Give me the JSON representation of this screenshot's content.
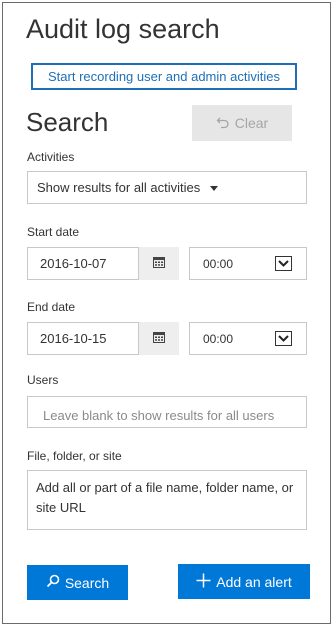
{
  "page": {
    "title": "Audit log search",
    "record_link": "Start recording user and admin activities",
    "search_heading": "Search",
    "clear_label": "Clear"
  },
  "activities": {
    "label": "Activities",
    "value": "Show results for all activities"
  },
  "start": {
    "label": "Start date",
    "date": "2016-10-07",
    "time": "00:00"
  },
  "end": {
    "label": "End date",
    "date": "2016-10-15",
    "time": "00:00"
  },
  "users": {
    "label": "Users",
    "placeholder": "Leave blank to show results for all users"
  },
  "file": {
    "label": "File, folder, or site",
    "placeholder": "Add all or part of a file name, folder name, or site URL"
  },
  "actions": {
    "search_label": "Search",
    "alert_label": "Add an alert"
  },
  "colors": {
    "accent": "#0078d7",
    "link": "#1f6fb5",
    "disabled_bg": "#e6e6e6"
  },
  "icons": [
    "undo-icon",
    "caret-down-icon",
    "calendar-icon",
    "chevron-down-icon",
    "search-icon",
    "plus-icon"
  ]
}
